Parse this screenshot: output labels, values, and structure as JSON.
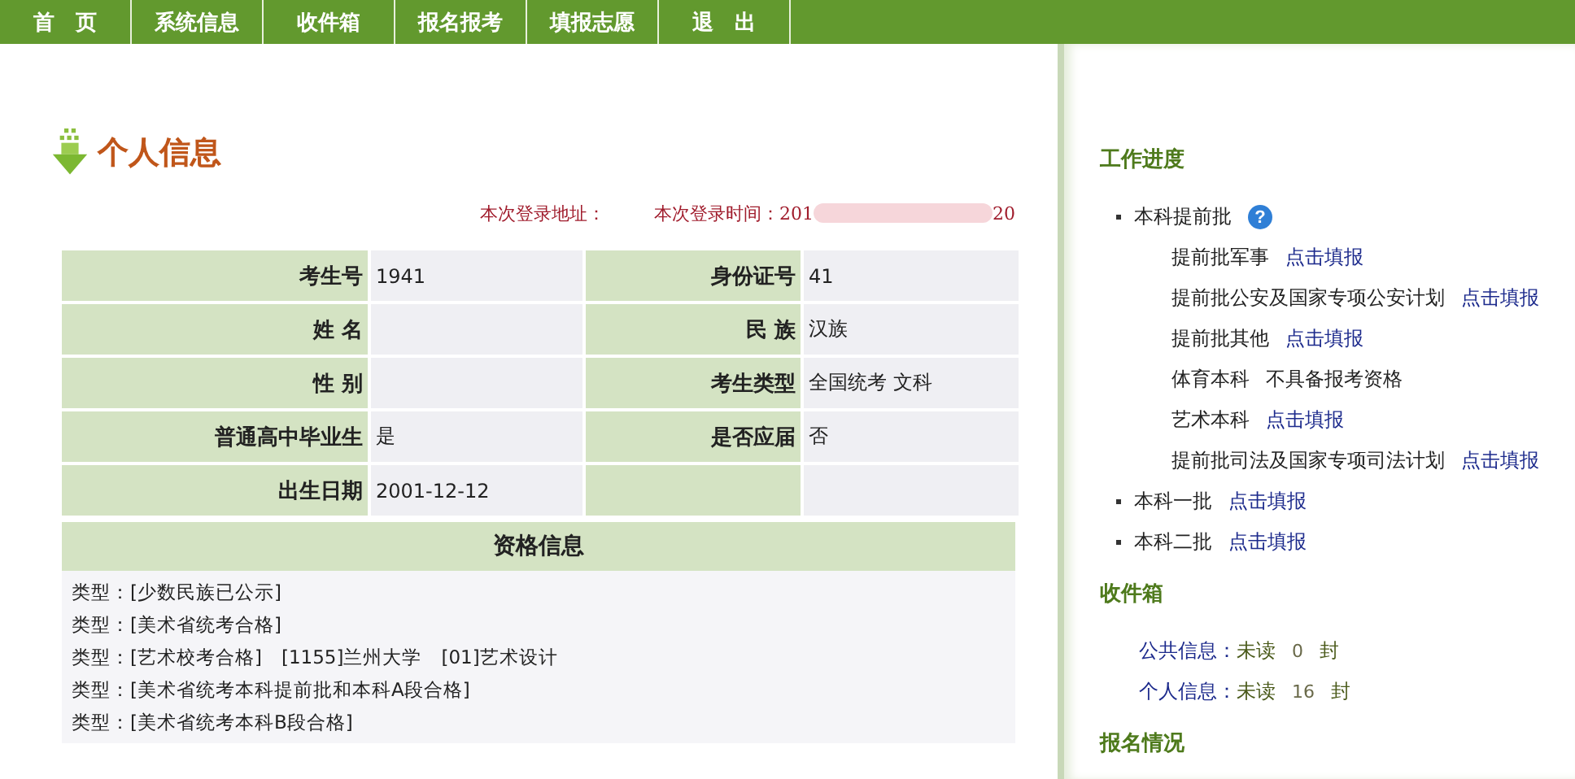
{
  "nav": [
    "首　页",
    "系统信息",
    "收件箱",
    "报名报考",
    "填报志愿",
    "退　出"
  ],
  "page_title": "个人信息",
  "login": {
    "address_label": "本次登录地址：",
    "time_label": "本次登录时间：",
    "time_start": "201",
    "time_end": "20"
  },
  "info_rows": [
    {
      "label": "考生号",
      "value": "1941",
      "label_2": "身份证号",
      "value_2": "41"
    },
    {
      "label": "姓 名",
      "value": "",
      "label_2": "民 族",
      "value_2": "汉族"
    },
    {
      "label": "性 别",
      "value": "",
      "label_2": "考生类型",
      "value_2": "全国统考 文科"
    },
    {
      "label": "普通高中毕业生",
      "value": "是",
      "label_2": "是否应届",
      "value_2": "否"
    },
    {
      "label": "出生日期",
      "value": "2001-12-12",
      "label_2": "",
      "value_2": ""
    }
  ],
  "qualification": {
    "title": "资格信息",
    "lines": [
      "类型：[少数民族已公示]",
      "类型：[美术省统考合格]",
      "类型：[艺术校考合格]　[1155]兰州大学　[01]艺术设计",
      "类型：[美术省统考本科提前批和本科A段合格]",
      "类型：[美术省统考本科B段合格]"
    ]
  },
  "progress": {
    "title": "工作进度",
    "items": [
      {
        "label": "本科提前批",
        "help": "?",
        "children": [
          {
            "label": "提前批军事",
            "kind": "link",
            "action": "点击填报"
          },
          {
            "label": "提前批公安及国家专项公安计划",
            "kind": "link",
            "action": "点击填报"
          },
          {
            "label": "提前批其他",
            "kind": "link",
            "action": "点击填报"
          },
          {
            "label": "体育本科",
            "kind": "status",
            "action": "不具备报考资格"
          },
          {
            "label": "艺术本科",
            "kind": "link",
            "action": "点击填报"
          },
          {
            "label": "提前批司法及国家专项司法计划",
            "kind": "link",
            "action": "点击填报"
          }
        ]
      },
      {
        "label": "本科一批",
        "kind": "link",
        "action": "点击填报"
      },
      {
        "label": "本科二批",
        "kind": "link",
        "action": "点击填报"
      }
    ]
  },
  "inbox": {
    "title": "收件箱",
    "rows": [
      {
        "label": "公共信息：",
        "state": "未读",
        "count": "0",
        "unit": "封"
      },
      {
        "label": "个人信息：",
        "state": "未读",
        "count": "16",
        "unit": "封"
      }
    ]
  },
  "registration": {
    "title": "报名情况"
  }
}
